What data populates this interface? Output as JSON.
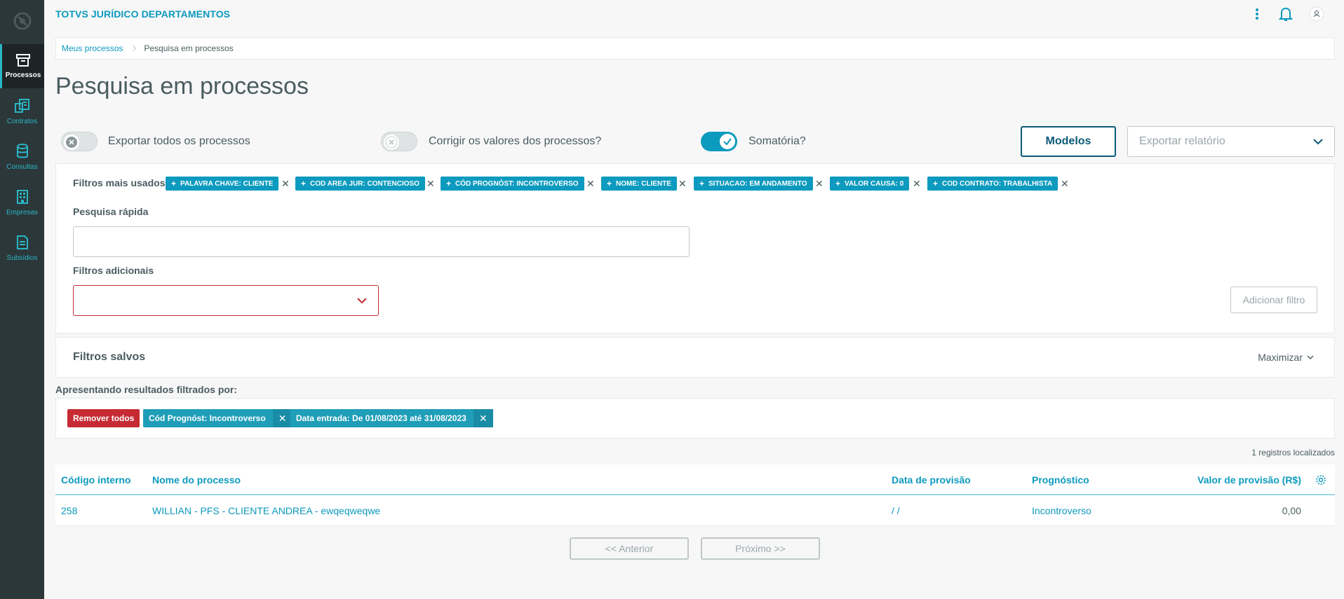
{
  "app": {
    "title": "TOTVS JURÍDICO DEPARTAMENTOS"
  },
  "sidebar": {
    "items": [
      {
        "label": "Processos",
        "icon": "archive-box-icon",
        "active": true
      },
      {
        "label": "Contratos",
        "icon": "contracts-icon"
      },
      {
        "label": "Consultas",
        "icon": "database-icon"
      },
      {
        "label": "Empresas",
        "icon": "building-icon"
      },
      {
        "label": "Subsídios",
        "icon": "document-icon"
      }
    ]
  },
  "breadcrumb": {
    "link": "Meus processos",
    "current": "Pesquisa em processos"
  },
  "page": {
    "title": "Pesquisa em processos"
  },
  "options": {
    "export_all": "Exportar todos os processos",
    "correct_values": "Corrigir os valores dos processos?",
    "sum": "Somatória?",
    "modelos": "Modelos",
    "export_report_placeholder": "Exportar relatório"
  },
  "filters": {
    "most_used_label": "Filtros mais usados",
    "chips": [
      "PALAVRA CHAVE: CLIENTE",
      "COD AREA JUR: CONTENCIOSO",
      "CÓD PROGNÓST: INCONTROVERSO",
      "NOME: CLIENTE",
      "SITUACAO: EM ANDAMENTO",
      "VALOR CAUSA: 0",
      "COD CONTRATO: TRABALHISTA"
    ],
    "quick_search_label": "Pesquisa rápida",
    "additional_label": "Filtros adicionais",
    "add_filter_button": "Adicionar filtro"
  },
  "saved_filters": {
    "title": "Filtros salvos",
    "maximize": "Maximizar"
  },
  "results": {
    "label": "Apresentando resultados filtrados por:",
    "remove_all": "Remover todos",
    "active_tags": [
      "Cód Prognóst: Incontroverso",
      "Data entrada: De 01/08/2023 até 31/08/2023"
    ],
    "count": "1 registros localizados"
  },
  "table": {
    "headers": [
      "Código interno",
      "Nome do processo",
      "Data de provisão",
      "Prognóstico",
      "Valor de provisão (R$)"
    ],
    "rows": [
      [
        "258",
        "WILLIAN - PFS - CLIENTE ANDREA - ewqeqweqwe",
        "/ /",
        "Incontroverso",
        "0,00"
      ]
    ]
  },
  "pagination": {
    "prev": "<< Anterior",
    "next": "Próximo >>"
  },
  "colors": {
    "accent": "#0c9abe",
    "sidebar": "#2c3739",
    "danger": "#c62b34",
    "primary_dark": "#0b5977"
  }
}
